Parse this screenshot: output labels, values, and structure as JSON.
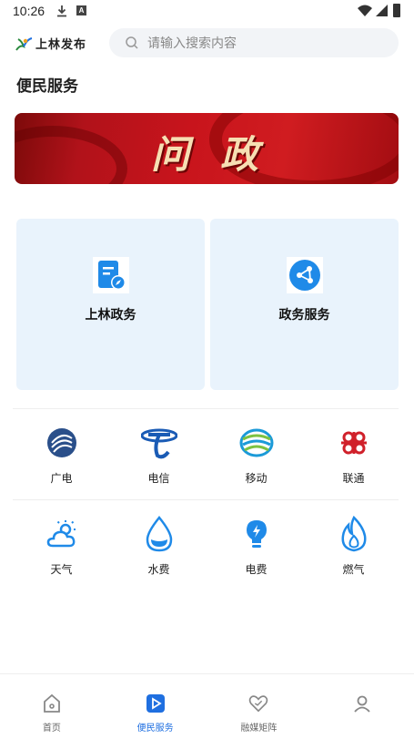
{
  "status_bar": {
    "time": "10:26",
    "icons": [
      "download-icon",
      "a-notification-icon",
      "wifi-icon",
      "signal-icon",
      "battery-icon"
    ]
  },
  "header": {
    "logo_text": "上林发布",
    "search_placeholder": "请输入搜索内容"
  },
  "page_title": "便民服务",
  "banner": {
    "text": "问政"
  },
  "cards": [
    {
      "label": "上林政务",
      "icon": "document-compass-icon"
    },
    {
      "label": "政务服务",
      "icon": "share-nodes-icon"
    }
  ],
  "services_row1": [
    {
      "label": "广电",
      "icon": "broadcast-tv-icon"
    },
    {
      "label": "电信",
      "icon": "china-telecom-icon"
    },
    {
      "label": "移动",
      "icon": "china-mobile-icon"
    },
    {
      "label": "联通",
      "icon": "china-unicom-icon"
    }
  ],
  "services_row2": [
    {
      "label": "天气",
      "icon": "weather-icon"
    },
    {
      "label": "水费",
      "icon": "water-drop-icon"
    },
    {
      "label": "电费",
      "icon": "electric-bulb-icon"
    },
    {
      "label": "燃气",
      "icon": "flame-icon"
    }
  ],
  "tabs": [
    {
      "label": "首页",
      "icon": "home-icon",
      "active": false
    },
    {
      "label": "便民服务",
      "icon": "play-square-icon",
      "active": true
    },
    {
      "label": "融媒矩阵",
      "icon": "heart-icon",
      "active": false
    },
    {
      "label": "",
      "icon": "profile-icon",
      "active": false
    }
  ],
  "colors": {
    "accent": "#1f6fe0",
    "card_bg": "#e9f3fc",
    "banner_red": "#c8141c"
  }
}
